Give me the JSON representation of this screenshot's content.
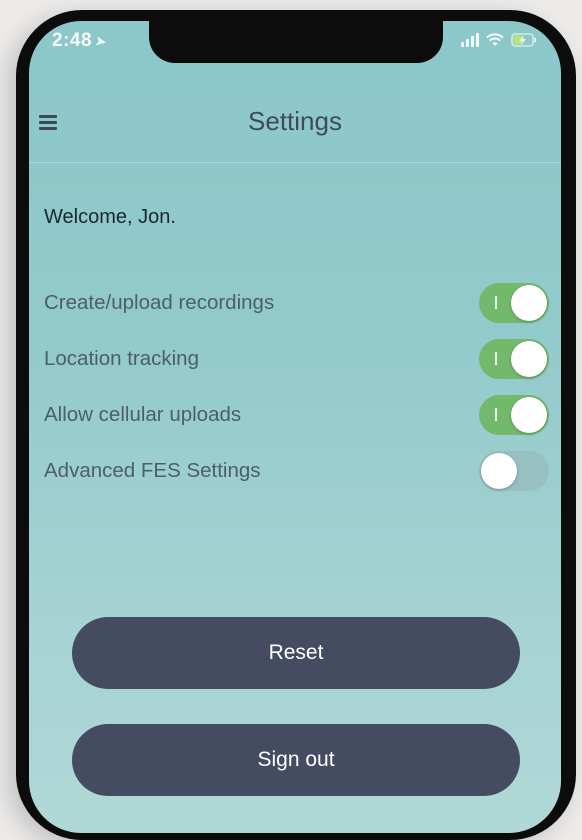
{
  "status_bar": {
    "time": "2:48",
    "location_icon": "location-arrow-icon",
    "signal_icon": "cellular-signal-icon",
    "wifi_icon": "wifi-icon",
    "battery_icon": "battery-charging-icon"
  },
  "header": {
    "title": "Settings",
    "menu_icon": "hamburger-menu-icon"
  },
  "welcome_text": "Welcome, Jon.",
  "settings": [
    {
      "label": "Create/upload recordings",
      "enabled": true
    },
    {
      "label": "Location tracking",
      "enabled": true
    },
    {
      "label": "Allow cellular uploads",
      "enabled": true
    },
    {
      "label": "Advanced FES Settings",
      "enabled": false
    }
  ],
  "buttons": {
    "reset_label": "Reset",
    "sign_out_label": "Sign out"
  },
  "colors": {
    "background_top": "#8cc7c9",
    "background_bottom": "#b0d8d7",
    "toggle_on": "#73b96b",
    "button_bg": "#454b60",
    "title_text": "#3e4b5e"
  }
}
